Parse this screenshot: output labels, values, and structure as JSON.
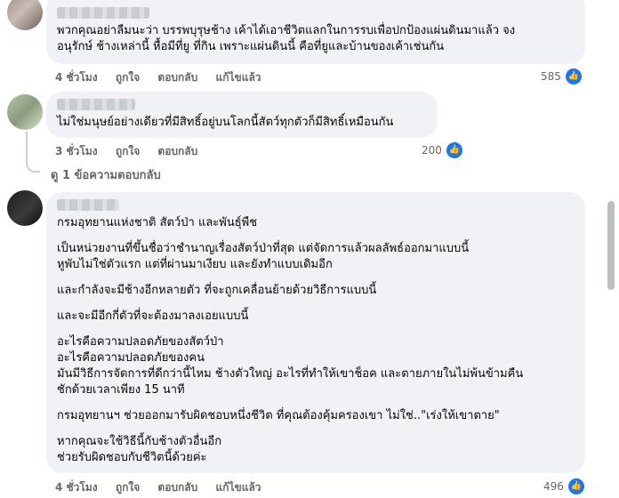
{
  "comments": [
    {
      "author": "",
      "text": "พวกคุณอย่าลืมนะว่า บรรพบุรุษช้าง เค้าได้เอาชีวิตแลกในการรบเพื่อปกป้องแผ่นดินมาแล้ว จง\nอนุรักษ์ ช้างเหล่านี้ หื้อมีที่ยู ที่กิน เพราะแผ่นดินนี้ คือที่ยูและบ้านของเค้าเช่นกัน",
      "time": "4 ชั่วโมง",
      "like": "ถูกใจ",
      "reply": "ตอบกลับ",
      "edited": "แก้ไขแล้ว",
      "reaction_count": "585",
      "reaction_icon": "thumbs-up-icon"
    },
    {
      "author": "",
      "text": "ไม่ใช่มนุษย์อย่างเดียวที่มีสิทธิ์อยู่บนโลกนี้สัตว์ทุกตัวก็มีสิทธิ์เหมือนกัน",
      "time": "3 ชั่วโมง",
      "like": "ถูกใจ",
      "reply": "ตอบกลับ",
      "reaction_count": "200",
      "reaction_icon": "thumbs-up-icon"
    },
    {
      "author": "",
      "paragraphs": [
        "กรมอุทยานแห่งชาติ สัตว์ป่า และพันธุ์พืช",
        "เป็นหน่วยงานที่ขึ้นชื่อว่าชำนาญเรื่องสัตว์ป่าที่สุด แต่จัดการแล้วผลลัพธ์ออกมาแบบนี้\nหูพับไม่ใช่ตัวแรก แต่ที่ผ่านมาเงียบ และยังทำแบบเดิมอีก",
        "และกำลังจะมีช้างอีกหลายตัว ที่จะถูกเคลื่อนย้ายด้วยวิธีการแบบนี้",
        "และจะมีอีกกี่ตัวที่จะต้องมาลงเอยแบบนี้",
        "อะไรคือความปลอดภัยของสัตว์ป่า\nอะไรคือความปลอดภัยของคน\nมันมีวิธีการจัดการที่ดีกว่านี้ไหม ช้างตัวใหญ่ อะไรที่ทำให้เขาช็อค และตายภายในไม่พ้นข้ามคืน\nชักด้วยเวลาเพียง 15 นาที",
        "กรมอุทยานฯ ช่วยออกมารับผิดชอบหนึ่งชีวิต ที่คุณต้องคุ้มครองเขา ไม่ใช่..\"เร่งให้เขาตาย\"",
        "หากคุณจะใช้วิธีนี้กับช้างตัวอื่นอีก\nช่วยรับผิดชอบกับชีวิตนี้ด้วยค่ะ"
      ],
      "time": "4 ชั่วโมง",
      "like": "ถูกใจ",
      "reply": "ตอบกลับ",
      "edited": "แก้ไขแล้ว",
      "reaction_count": "496",
      "reaction_icon": "thumbs-up-icon"
    }
  ],
  "view_replies": "ดู 1 ข้อความตอบกลับ",
  "colors": {
    "bubble": "#f0f2f5",
    "meta_text": "#65676b",
    "like_blue": "#1877f2"
  }
}
